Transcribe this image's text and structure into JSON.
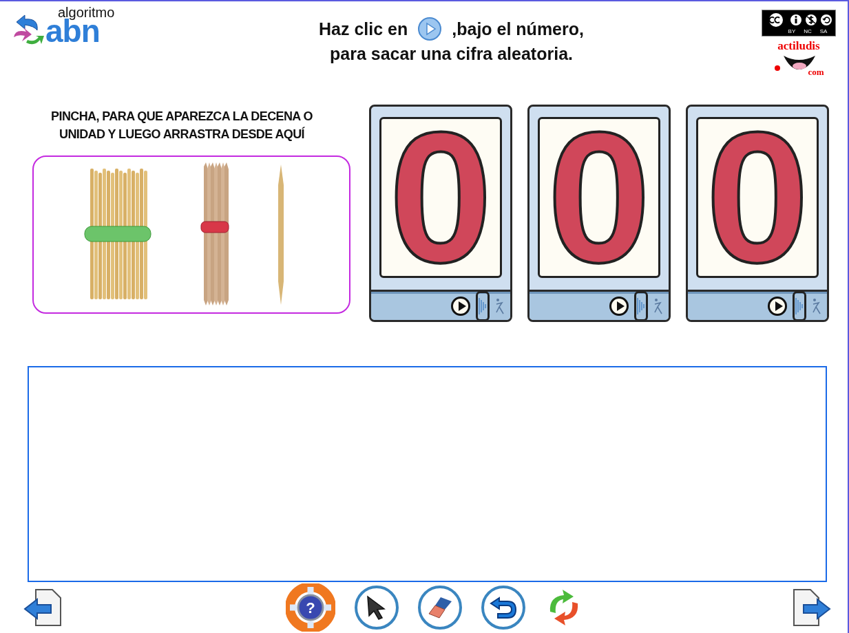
{
  "logo": {
    "top": "algoritmo",
    "main": "abn"
  },
  "instruction": {
    "before": "Haz clic en",
    "after": ",bajo el número,",
    "line2": "para sacar una cifra aleatoria."
  },
  "license": {
    "labels": [
      "BY",
      "NC",
      "SA"
    ]
  },
  "brand": {
    "name": "actiludis",
    "suffix": "com"
  },
  "tray": {
    "caption": [
      "PINCHA, PARA QUE APAREZCA LA DECENA O",
      "UNIDAD Y LUEGO ARRASTRA  DESDE AQUÍ"
    ],
    "items": [
      {
        "kind": "hundred"
      },
      {
        "kind": "ten"
      },
      {
        "kind": "unit"
      }
    ]
  },
  "counters": [
    {
      "digit": "0"
    },
    {
      "digit": "0"
    },
    {
      "digit": "0"
    }
  ],
  "toolbar": [
    {
      "kind": "help",
      "symbol": "?"
    },
    {
      "kind": "pointer"
    },
    {
      "kind": "eraser"
    },
    {
      "kind": "undo"
    },
    {
      "kind": "refresh"
    }
  ],
  "nav": [
    {
      "kind": "back"
    },
    {
      "kind": "forward"
    }
  ]
}
